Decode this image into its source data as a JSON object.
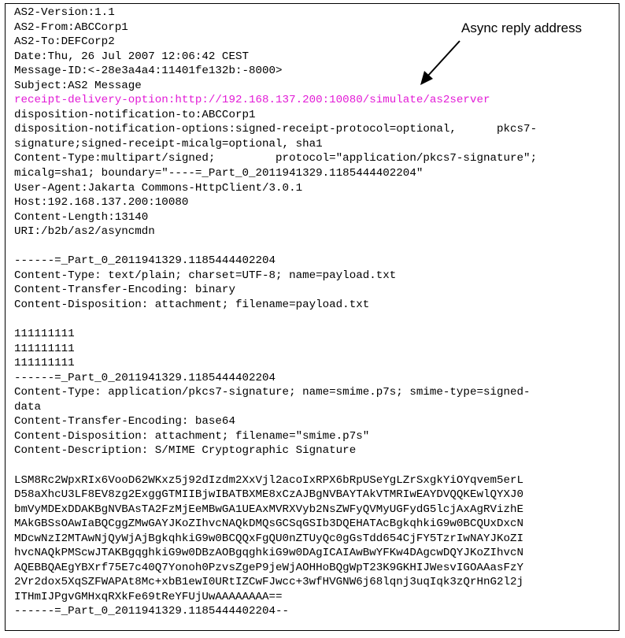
{
  "callout": {
    "text": "Async reply address"
  },
  "colors": {
    "highlight": "#e21bd6",
    "text": "#000000",
    "border": "#000000"
  },
  "headers": [
    "AS2-Version:1.1",
    "AS2-From:ABCCorp1",
    "AS2-To:DEFCorp2",
    "Date:Thu, 26 Jul 2007 12:06:42 CEST",
    "Message-ID:<-28e3a4a4:11401fe132b:-8000>",
    "Subject:AS2 Message",
    "receipt-delivery-option:http://192.168.137.200:10080/simulate/as2server",
    "disposition-notification-to:ABCCorp1",
    "disposition-notification-options:signed-receipt-protocol=optional,      pkcs7-",
    "signature;signed-receipt-micalg=optional, sha1",
    "Content-Type:multipart/signed;         protocol=\"application/pkcs7-signature\";",
    "micalg=sha1; boundary=\"----=_Part_0_2011941329.1185444402204\"",
    "User-Agent:Jakarta Commons-HttpClient/3.0.1",
    "Host:192.168.137.200:10080",
    "Content-Length:13140",
    "URI:/b2b/as2/asyncmdn"
  ],
  "part1": [
    "------=_Part_0_2011941329.1185444402204",
    "Content-Type: text/plain; charset=UTF-8; name=payload.txt",
    "Content-Transfer-Encoding: binary",
    "Content-Disposition: attachment; filename=payload.txt"
  ],
  "payload": [
    "111111111",
    "111111111",
    "111111111"
  ],
  "part2": [
    "------=_Part_0_2011941329.1185444402204",
    "Content-Type: application/pkcs7-signature; name=smime.p7s; smime-type=signed-",
    "data",
    "Content-Transfer-Encoding: base64",
    "Content-Disposition: attachment; filename=\"smime.p7s\"",
    "Content-Description: S/MIME Cryptographic Signature"
  ],
  "signature": [
    "LSM8Rc2WpxRIx6VooD62WKxz5j92dIzdm2XxVjl2acoIxRPX6bRpUSeYgLZrSxgkYiOYqvem5erL",
    "D58aXhcU3LF8EV8zg2ExggGTMIIBjwIBATBXME8xCzAJBgNVBAYTAkVTMRIwEAYDVQQKEwlQYXJ0",
    "bmVyMDExDDAKBgNVBAsTA2FzMjEeMBwGA1UEAxMVRXVyb2NsZWFyQVMyUGFydG5lcjAxAgRVizhE",
    "MAkGBSsOAwIaBQCggZMwGAYJKoZIhvcNAQkDMQsGCSqGSIb3DQEHATAcBgkqhkiG9w0BCQUxDxcN",
    "MDcwNzI2MTAwNjQyWjAjBgkqhkiG9w0BCQQxFgQU0nZTUyQc0gGsTdd654CjFY5TzrIwNAYJKoZI",
    "hvcNAQkPMScwJTAKBgqghkiG9w0DBzAOBgqghkiG9w0DAgICAIAwBwYFKw4DAgcwDQYJKoZIhvcN",
    "AQEBBQAEgYBXrf75E7c40Q7Yonoh0PzvsZgeP9jeWjAOHHoBQgWpT23K9GKHIJWesvIGOAAasFzY",
    "2Vr2dox5XqSZFWAPAt8Mc+xbB1ewI0URtIZCwFJwcc+3wfHVGNW6j68lqnj3uqIqk3zQrHnG2l2j",
    "ITHmIJPgvGMHxqRXkFe69tReYFUjUwAAAAAAAA==",
    "------=_Part_0_2011941329.1185444402204--"
  ]
}
